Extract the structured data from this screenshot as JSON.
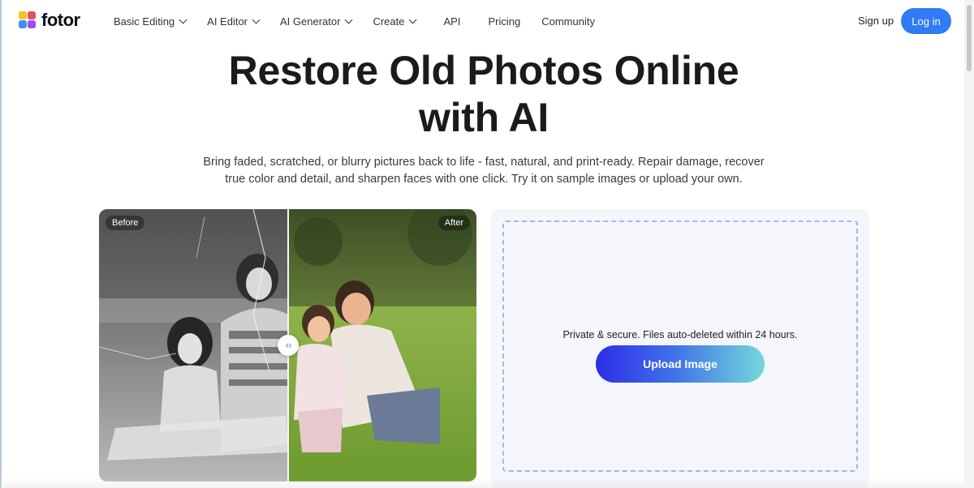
{
  "brand": {
    "name": "fotor",
    "colors": [
      "#f8c31c",
      "#ef4b5c",
      "#3e8ef7",
      "#9b4ff2"
    ]
  },
  "nav": {
    "items": [
      {
        "label": "Basic Editing",
        "dropdown": true
      },
      {
        "label": "AI Editor",
        "dropdown": true
      },
      {
        "label": "AI Generator",
        "dropdown": true
      },
      {
        "label": "Create",
        "dropdown": true
      },
      {
        "label": "API",
        "dropdown": false
      },
      {
        "label": "Pricing",
        "dropdown": false
      },
      {
        "label": "Community",
        "dropdown": false
      }
    ],
    "signup_label": "Sign up",
    "login_label": "Log in"
  },
  "hero": {
    "title_line1": "Restore Old Photos Online",
    "title_line2": "with AI",
    "subtitle_line1": "Bring faded, scratched, or blurry pictures back to life - fast, natural, and print-ready. Repair damage, recover",
    "subtitle_line2": "true color and detail, and sharpen faces with one click. Try it on sample images or upload your own."
  },
  "compare": {
    "before_label": "Before",
    "after_label": "After",
    "handle_icon": "arrows-left-right-icon"
  },
  "upload": {
    "privacy_text": "Private & secure. Files auto-deleted within 24 hours.",
    "button_label": "Upload Image"
  },
  "colors": {
    "accent": "#2f7cf6",
    "upload_gradient_start": "#2e2de6",
    "upload_gradient_end": "#74d8da",
    "dropzone_border": "#9dbbe6"
  }
}
